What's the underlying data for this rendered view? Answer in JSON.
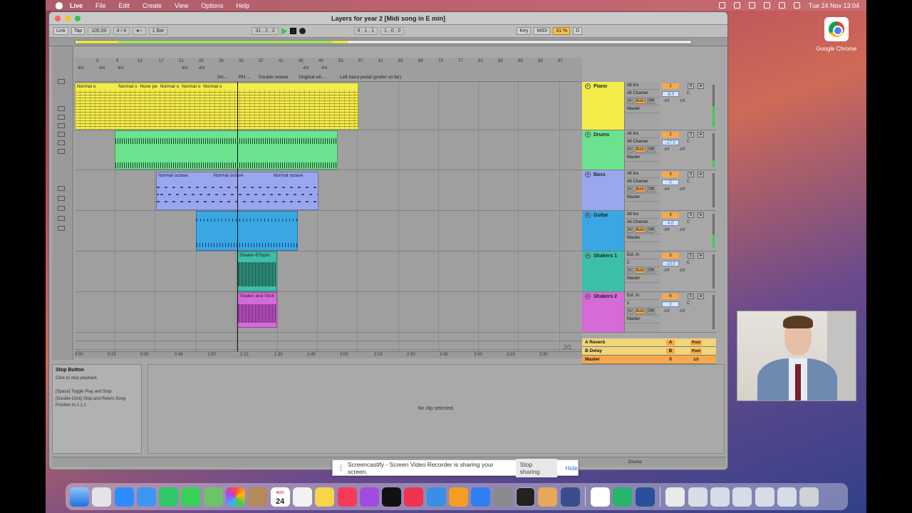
{
  "menubar": {
    "app": "Live",
    "items": [
      "File",
      "Edit",
      "Create",
      "View",
      "Options",
      "Help"
    ],
    "clock": "Tue 24 Nov  13:04"
  },
  "desktop": {
    "chrome_label": "Google Chrome"
  },
  "window": {
    "title": "Layers for year 2  [Midi song in E min]",
    "transport": {
      "link": "Link",
      "tap": "Tap",
      "tempo": "105.00",
      "signature": "4 / 4",
      "quantize": "1 Bar",
      "position": "31 .  2 .  2",
      "loop_start": "8 .  1 .  1",
      "loop_length": "1 .  0 .  0",
      "key": "Key",
      "midi": "MIDI",
      "cpu": "31 %",
      "d": "D"
    },
    "ruler": {
      "bars": [
        "5",
        "9",
        "13",
        "17",
        "21",
        "25",
        "29",
        "33",
        "37",
        "41",
        "45",
        "49",
        "53",
        "57",
        "61",
        "65",
        "69",
        "73",
        "77",
        "81",
        "85",
        "89",
        "93",
        "97"
      ],
      "sigs": [
        "4/4",
        "4/4",
        "4/4",
        "4/4",
        "4/4",
        "4/4",
        "4/4"
      ],
      "locators": [
        "Ori...",
        "RH ...",
        "Double octave",
        "Original wit...",
        "Left hand pedal (prefer so far)"
      ]
    },
    "timeline": [
      "0:00",
      "0:15",
      "0:30",
      "0:45",
      "1:00",
      "1:15",
      "1:30",
      "1:45",
      "2:00",
      "2:15",
      "2:30",
      "2:45",
      "3:00",
      "3:15",
      "3:30"
    ],
    "pager": "2/1",
    "clips": {
      "piano": [
        "Normal o",
        "Normal o",
        "None pe",
        "Normal o",
        "Normal o",
        "Normal o"
      ],
      "bass": [
        "Normal octave",
        "Normal octave",
        "Normal octave"
      ],
      "shaker1": "Shaker-67bpm",
      "shaker2": "Shaker and Stick"
    },
    "tracks": [
      {
        "name": "Piano",
        "color": "#f4ec4a",
        "input": "All Ins",
        "channel": "All Channe",
        "num": "1",
        "vol": "-8.0",
        "pan": "C",
        "out": "Master"
      },
      {
        "name": "Drums",
        "color": "#6be38e",
        "input": "All Ins",
        "channel": "All Channe",
        "num": "2",
        "vol": "-17.0",
        "pan": "C",
        "out": "Master"
      },
      {
        "name": "Bass",
        "color": "#9aa7ef",
        "input": "All Ins",
        "channel": "All Channe",
        "num": "3",
        "vol": "0",
        "pan": "C",
        "out": "Master"
      },
      {
        "name": "Guitar",
        "color": "#3aa6e3",
        "input": "All Ins",
        "channel": "All Channe",
        "num": "4",
        "vol": "4.0",
        "pan": "C",
        "out": "Master"
      },
      {
        "name": "Shakers 1",
        "color": "#3bbfa9",
        "input": "Ext. In",
        "channel": "1",
        "num": "5",
        "vol": "-10.0",
        "pan": "C",
        "out": "Master"
      },
      {
        "name": "Shakers 2",
        "color": "#d56ad8",
        "input": "Ext. In",
        "channel": "1",
        "num": "6",
        "vol": "0",
        "pan": "C",
        "out": "Master"
      }
    ],
    "monitor": {
      "in": "In",
      "auto": "Auto",
      "off": "Off",
      "inf": "-inf",
      "solo": "S"
    },
    "returns": [
      {
        "name": "A Reverb",
        "num": "A",
        "post": "Post"
      },
      {
        "name": "B Delay",
        "num": "B",
        "post": "Post"
      },
      {
        "name": "Master",
        "num": "0",
        "post": "1/2"
      }
    ],
    "info": {
      "title": "Stop Button",
      "text": "Click to stop playback.\n\n[Space] Toggle Play and Stop\n[Double-Click] Stop and Return Song\nPosition to 1.1.1"
    },
    "detail_msg": "No clip selected.",
    "status_track": "Drums"
  },
  "screencastify": {
    "message": "Screencastify - Screen Video Recorder is sharing your screen.",
    "stop": "Stop sharing",
    "hide": "Hide"
  },
  "dock": {
    "calendar_day": "24",
    "calendar_month": "NOV"
  }
}
